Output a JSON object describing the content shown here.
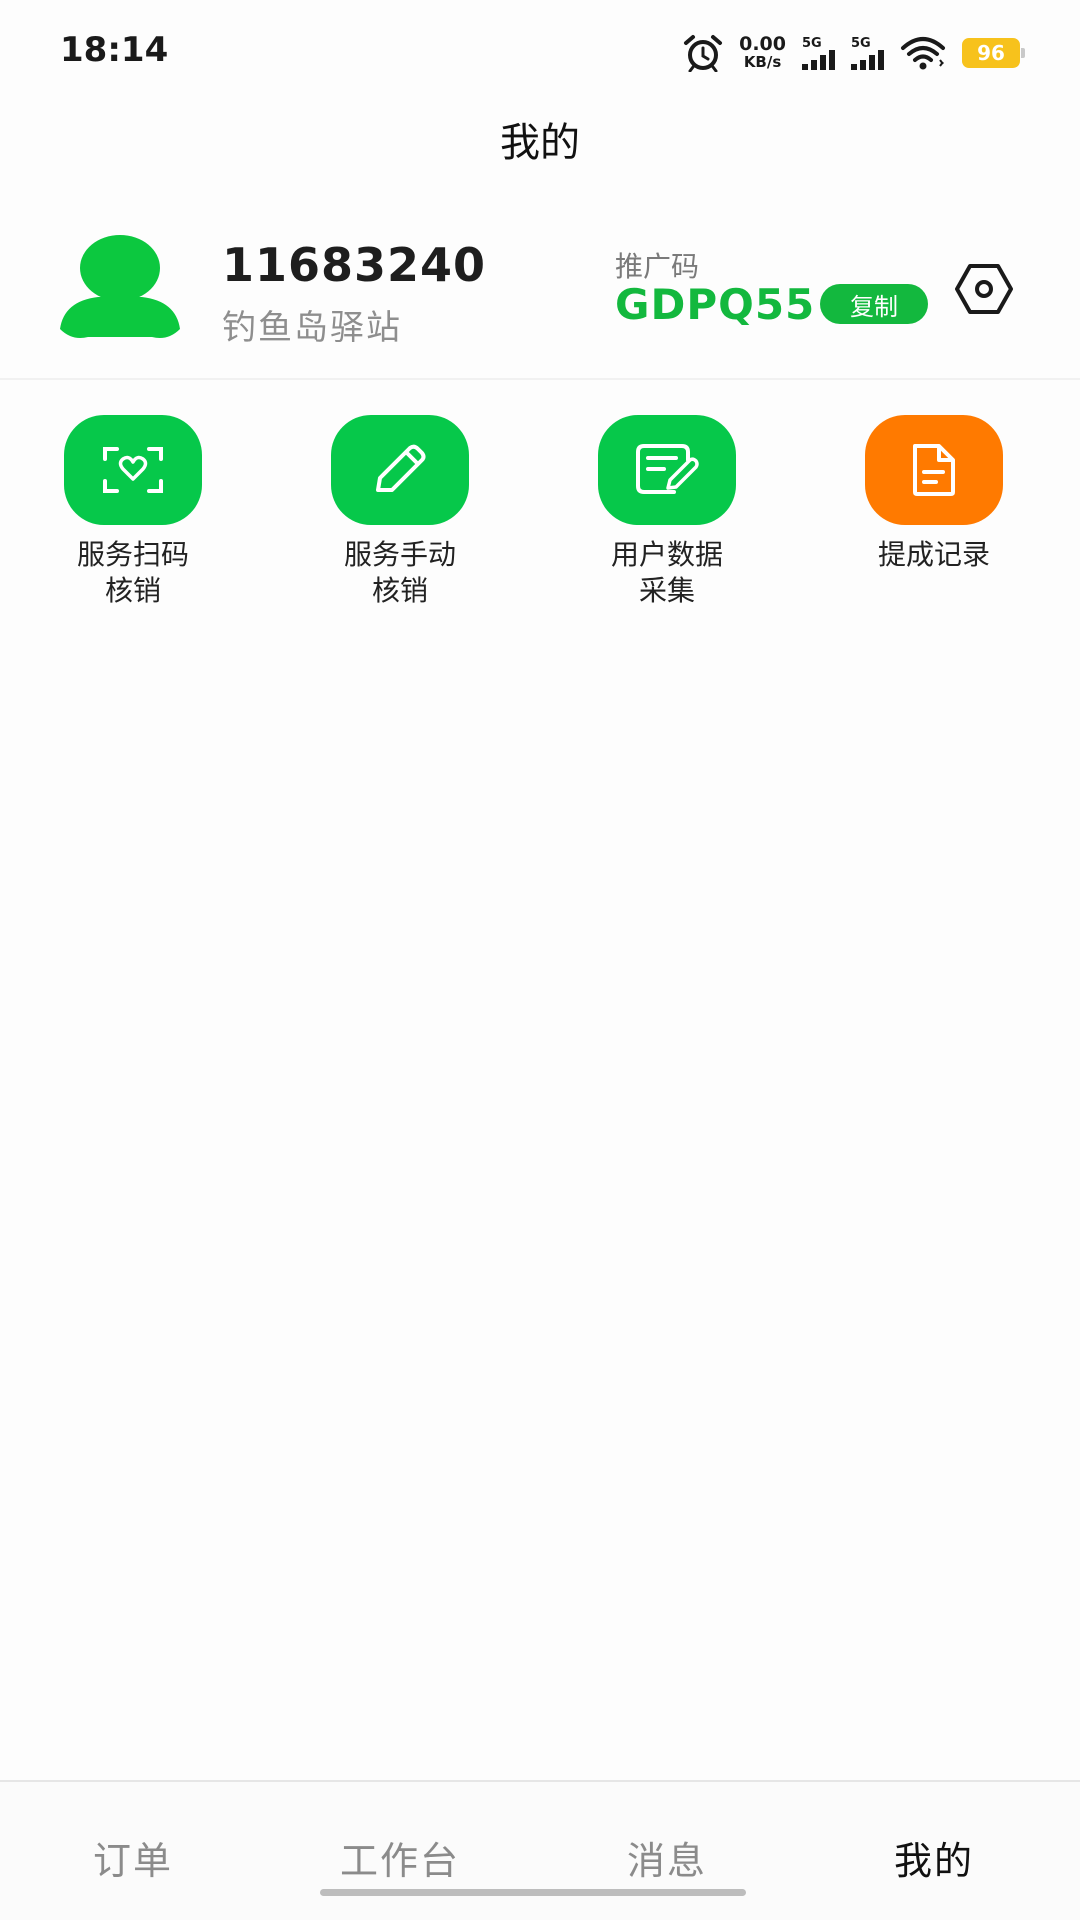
{
  "status_bar": {
    "time": "18:14",
    "net_speed_value": "0.00",
    "net_speed_unit": "KB/s",
    "signal1_label": "5G",
    "signal2_label": "5G",
    "battery": "96",
    "icons": [
      "alarm-icon",
      "signal-icon",
      "signal-icon",
      "wifi-icon",
      "battery-icon"
    ],
    "battery_color": "#f7c21c"
  },
  "header": {
    "title": "我的"
  },
  "profile": {
    "user_id": "11683240",
    "station": "钓鱼岛驿站",
    "promo_label": "推广码",
    "promo_code": "GDPQ55",
    "copy_label": "复制",
    "avatar_icon": "user-avatar-icon",
    "settings_icon": "hexagon-settings-icon"
  },
  "actions": [
    {
      "line1": "服务扫码",
      "line2": "核销",
      "icon": "scan-heart-icon",
      "color": "#06c84a"
    },
    {
      "line1": "服务手动",
      "line2": "核销",
      "icon": "pencil-icon",
      "color": "#06c84a"
    },
    {
      "line1": "用户数据",
      "line2": "采集",
      "icon": "edit-card-icon",
      "color": "#06c84a"
    },
    {
      "line1": "提成记录",
      "line2": "",
      "icon": "document-icon",
      "color": "#ff7a00"
    }
  ],
  "bottom_nav": [
    {
      "label": "订单",
      "active": false
    },
    {
      "label": "工作台",
      "active": false
    },
    {
      "label": "消息",
      "active": false
    },
    {
      "label": "我的",
      "active": true
    }
  ],
  "colors": {
    "accent": "#13b83e",
    "tile_green": "#06c84a",
    "tile_orange": "#ff7a00"
  }
}
